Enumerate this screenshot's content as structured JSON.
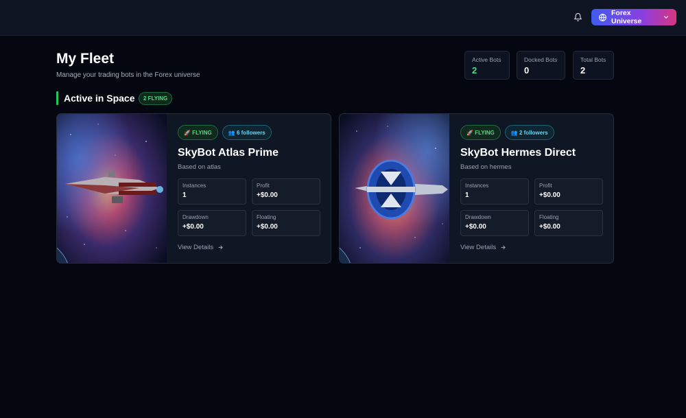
{
  "header": {
    "notification_icon": "bell-icon",
    "universe_button": {
      "label": "Forex Universe",
      "icon": "globe-icon",
      "chevron": "chevron-down-icon"
    }
  },
  "page": {
    "title": "My Fleet",
    "subtitle": "Manage your trading bots in the Forex universe"
  },
  "stats": [
    {
      "label": "Active Bots",
      "value": "2"
    },
    {
      "label": "Docked Bots",
      "value": "0"
    },
    {
      "label": "Total Bots",
      "value": "2"
    }
  ],
  "section": {
    "title": "Active in Space",
    "badge": "2 FLYING"
  },
  "bots": [
    {
      "status_badge": "🚀 FLYING",
      "followers_badge": "👥 6 followers",
      "name": "SkyBot Atlas Prime",
      "based_on": "Based on atlas",
      "metrics": [
        {
          "label": "Instances",
          "value": "1"
        },
        {
          "label": "Profit",
          "value": "+$0.00"
        },
        {
          "label": "Drawdown",
          "value": "+$0.00"
        },
        {
          "label": "Floating",
          "value": "+$0.00"
        }
      ],
      "view_details": "View Details"
    },
    {
      "status_badge": "🚀 FLYING",
      "followers_badge": "👥 2 followers",
      "name": "SkyBot Hermes Direct",
      "based_on": "Based on hermes",
      "metrics": [
        {
          "label": "Instances",
          "value": "1"
        },
        {
          "label": "Profit",
          "value": "+$0.00"
        },
        {
          "label": "Drawdown",
          "value": "+$0.00"
        },
        {
          "label": "Floating",
          "value": "+$0.00"
        }
      ],
      "view_details": "View Details"
    }
  ],
  "colors": {
    "background": "#04070f",
    "accent_green": "#4ade80",
    "accent_cyan": "#67d4f0",
    "button_gradient_start": "#3f5cf0",
    "button_gradient_end": "#d9357f"
  }
}
